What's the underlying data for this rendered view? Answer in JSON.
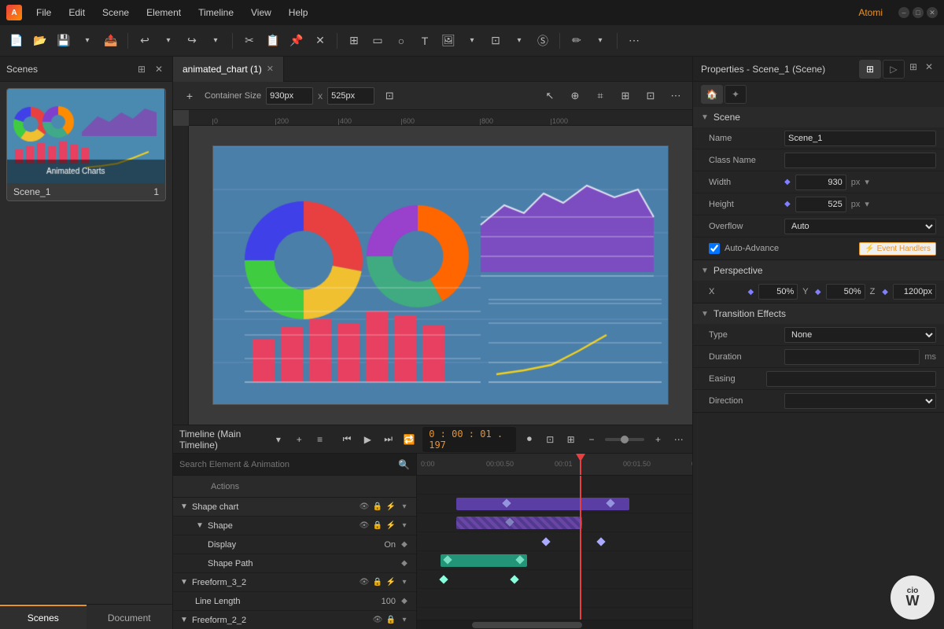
{
  "titlebar": {
    "logo_text": "A",
    "menus": [
      "File",
      "Edit",
      "Scene",
      "Element",
      "Timeline",
      "View",
      "Help"
    ],
    "atomi_link": "Atomi",
    "win_min": "–",
    "win_max": "□",
    "win_close": "✕"
  },
  "tab_bar": {
    "tab_label": "animated_chart (1)",
    "tab_close": "✕"
  },
  "canvas_toolbar": {
    "container_size_label": "Container Size",
    "width_value": "930px",
    "height_value": "525px"
  },
  "scenes_panel": {
    "title": "Scenes",
    "scene_name": "Scene_1",
    "scene_number": "1",
    "tabs": [
      "Scenes",
      "Document"
    ]
  },
  "properties_panel": {
    "title": "Properties - Scene_1 (Scene)",
    "scene_section": "Scene",
    "name_label": "Name",
    "name_value": "Scene_1",
    "class_name_label": "Class Name",
    "class_name_value": "",
    "width_label": "Width",
    "width_value": "930",
    "width_unit": "px",
    "height_label": "Height",
    "height_value": "525",
    "height_unit": "px",
    "overflow_label": "Overflow",
    "overflow_value": "Auto",
    "auto_advance_label": "Auto-Advance",
    "event_handlers_btn": "⚡ Event Handlers",
    "perspective_section": "Perspective",
    "perspective_x_label": "X",
    "perspective_x_value": "50%",
    "perspective_y_label": "Y",
    "perspective_y_value": "50%",
    "perspective_z_label": "Z",
    "perspective_z_value": "1200px",
    "transition_section": "Transition Effects",
    "type_label": "Type",
    "type_value": "None",
    "duration_label": "Duration",
    "duration_value": "",
    "duration_unit": "ms",
    "easing_label": "Easing",
    "easing_value": "",
    "direction_label": "Direction",
    "direction_value": ""
  },
  "timeline": {
    "title": "Timeline (Main Timeline)",
    "time_display": "0 : 00  :  01 . 197",
    "search_placeholder": "Search Element & Animation",
    "tracks_header": [
      "",
      "Actions"
    ],
    "tracks": [
      {
        "id": "shape-chart",
        "name": "Shape chart",
        "indent": 0,
        "is_group": true,
        "value": ""
      },
      {
        "id": "shape",
        "name": "Shape",
        "indent": 1,
        "is_group": false,
        "value": ""
      },
      {
        "id": "display",
        "name": "Display",
        "indent": 2,
        "is_group": false,
        "value": "On"
      },
      {
        "id": "shape-path",
        "name": "Shape Path",
        "indent": 2,
        "is_group": false,
        "value": ""
      },
      {
        "id": "freeform-3-2",
        "name": "Freeform_3_2",
        "indent": 0,
        "is_group": false,
        "value": ""
      },
      {
        "id": "line-length",
        "name": "Line Length",
        "indent": 1,
        "is_group": false,
        "value": "100"
      },
      {
        "id": "freeform-2-2",
        "name": "Freeform_2_2",
        "indent": 0,
        "is_group": false,
        "value": ""
      }
    ]
  },
  "icons": {
    "search": "🔍",
    "eye": "👁",
    "lock": "🔒",
    "lightning": "⚡",
    "play": "▶",
    "pause": "⏸",
    "skip_back": "⏮",
    "skip_fwd": "⏭",
    "loop": "🔁",
    "record": "⏺",
    "expand": "▼",
    "collapse": "▶",
    "chevron_right": "›",
    "chevron_down": "▾",
    "diamond": "◆",
    "plus": "+",
    "minus": "−"
  }
}
